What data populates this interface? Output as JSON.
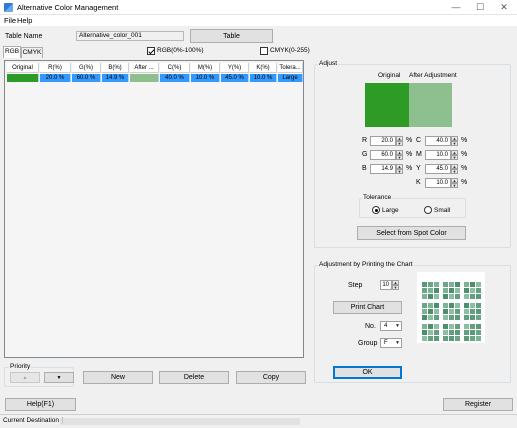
{
  "window": {
    "title": "Alternative Color Management",
    "controls": [
      "—",
      "☐",
      "✕"
    ]
  },
  "menu": {
    "file": "File",
    "help": "Help"
  },
  "top": {
    "table_name_label": "Table Name",
    "table_name_value": "Alternative_color_001",
    "table_button": "Table"
  },
  "tabs": {
    "rgb": "RGB",
    "cmyk": "CMYK"
  },
  "checkboxes": {
    "rgb_percent": "RGB(0%-100%)",
    "cmyk_range": "CMYK(0-255)"
  },
  "grid": {
    "headers": [
      "Original",
      "R(%)",
      "G(%)",
      "B(%)",
      "After ...",
      "C(%)",
      "M(%)",
      "Y(%)",
      "K(%)",
      "Tolera..."
    ],
    "row": {
      "original_color": "#2d9b25",
      "r": "20.0 %",
      "g": "60.0 %",
      "b": "14.9 %",
      "after_color": "#8ebf8e",
      "c": "40.0 %",
      "m": "10.0 %",
      "y": "45.0 %",
      "k": "10.0 %",
      "tolerance": "Large"
    }
  },
  "priority": {
    "label": "Priority",
    "up": "▲",
    "down": "▼"
  },
  "actions": {
    "new": "New",
    "delete": "Delete",
    "copy": "Copy"
  },
  "adjust": {
    "label": "Adjust",
    "original_header": "Original",
    "after_header": "After Adjustment",
    "original_color": "#2d9b25",
    "after_color": "#8ebf8e",
    "fields": {
      "r_label": "R",
      "r_value": "20.0",
      "r_unit": "%",
      "g_label": "G",
      "g_value": "60.0",
      "g_unit": "%",
      "b_label": "B",
      "b_value": "14.9",
      "b_unit": "%",
      "c_label": "C",
      "c_value": "40.0",
      "c_unit": "%",
      "m_label": "M",
      "m_value": "10.0",
      "m_unit": "%",
      "y_label": "Y",
      "y_value": "45.0",
      "y_unit": "%",
      "k_label": "K",
      "k_value": "10.0",
      "k_unit": "%"
    },
    "tolerance_label": "Tolerance",
    "tolerance_large": "Large",
    "tolerance_small": "Small",
    "spot_button": "Select from Spot Color"
  },
  "printing": {
    "label": "Adjustment by Printing the Chart",
    "step_label": "Step",
    "step_value": "10",
    "print_button": "Print Chart",
    "no_label": "No.",
    "no_value": "4",
    "group_label": "Group",
    "group_value": "F",
    "ok_button": "OK"
  },
  "bottom": {
    "help_button": "Help(F1)",
    "register_button": "Register"
  },
  "status": {
    "destination_label": "Current Destination"
  }
}
